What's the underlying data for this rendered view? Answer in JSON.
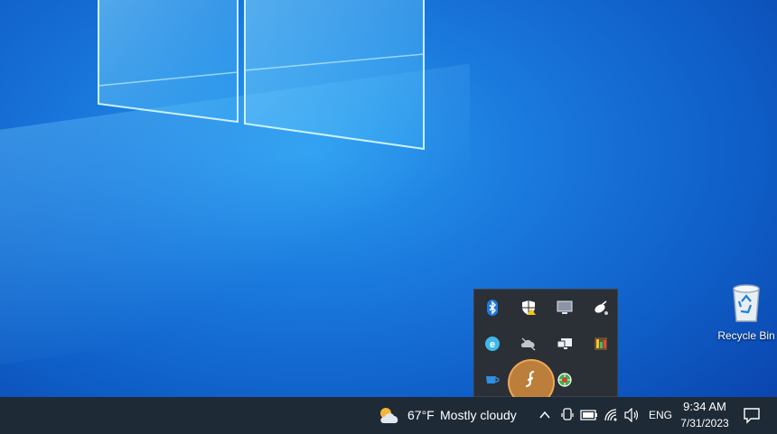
{
  "desktop": {
    "recycle_bin_label": "Recycle Bin"
  },
  "tray_flyout": {
    "icons": [
      "bluetooth-icon",
      "windows-security-icon",
      "display-icon",
      "satellite-icon",
      "edge-icon",
      "onedrive-offline-icon",
      "network-monitor-icon",
      "app-icon",
      "cup-icon",
      "swirl-app-icon",
      "globe-app-icon"
    ]
  },
  "taskbar": {
    "weather_temp": "67°F",
    "weather_text": "Mostly cloudy",
    "language": "ENG",
    "time": "9:34 AM",
    "date": "7/31/2023"
  },
  "colors": {
    "taskbar": "#1e2a35",
    "flyout": "#2b2f36",
    "highlight": "#d68c3c"
  }
}
